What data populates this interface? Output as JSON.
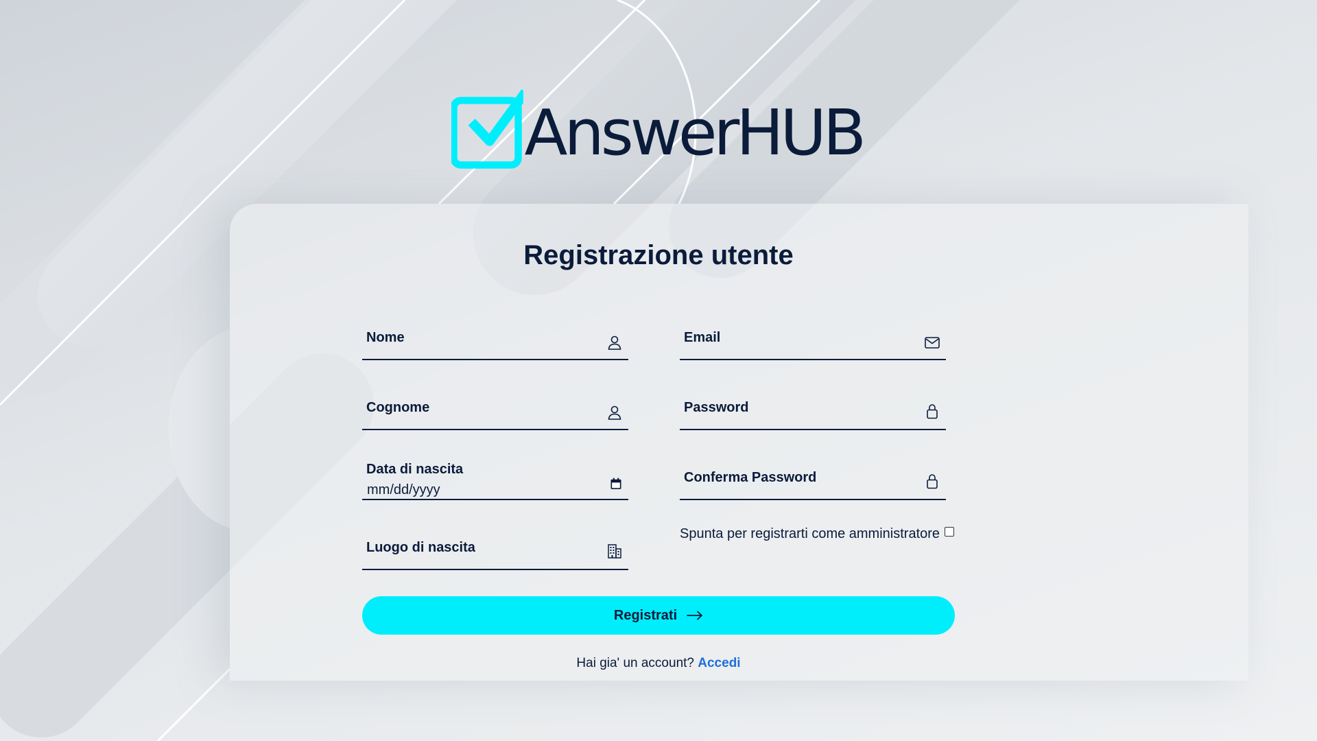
{
  "brand": {
    "name": "AnswerHUB",
    "accent_color": "#00eefc",
    "text_color": "#0b1b3a",
    "logo_icon": "checkbox-check-icon"
  },
  "form": {
    "title": "Registrazione utente",
    "fields": {
      "nome": {
        "label": "Nome",
        "icon": "user-icon"
      },
      "email": {
        "label": "Email",
        "icon": "envelope-icon"
      },
      "cognome": {
        "label": "Cognome",
        "icon": "user-icon"
      },
      "password": {
        "label": "Password",
        "icon": "lock-icon"
      },
      "data_nascita": {
        "label": "Data di nascita",
        "placeholder": "mm/dd/yyyy",
        "icon": "calendar-icon"
      },
      "conferma_password": {
        "label": "Conferma Password",
        "icon": "lock-icon"
      },
      "luogo_nascita": {
        "label": "Luogo di nascita",
        "icon": "building-icon"
      }
    },
    "admin_checkbox": {
      "label": "Spunta per registrarti come amministratore",
      "checked": false
    },
    "submit_label": "Registrati",
    "submit_icon": "arrow-right-icon",
    "login_prompt": "Hai gia' un account?",
    "login_link": "Accedi",
    "link_color": "#1e6fd9"
  }
}
